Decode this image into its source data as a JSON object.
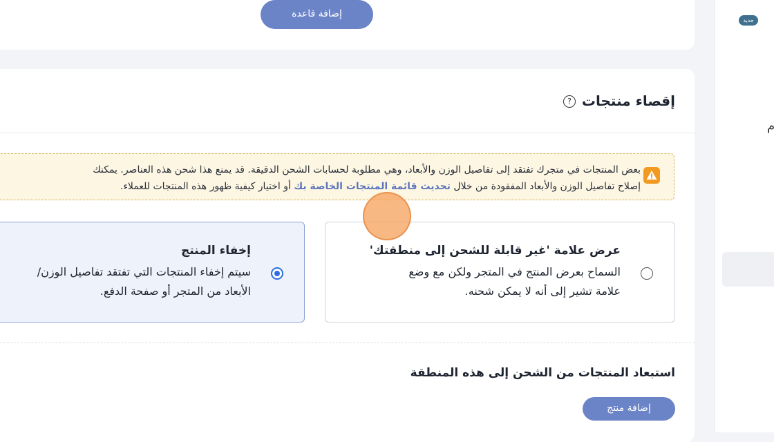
{
  "sidebar": {
    "new_badge": "جديد",
    "partial_glyph": "م"
  },
  "rules": {
    "add_rule_button": "إضافة قاعدة"
  },
  "exclusion": {
    "title": "إقصاء منتجات",
    "help_icon_glyph": "?",
    "warning": {
      "icon": "warning-triangle-icon",
      "line1": "بعض المنتجات في متجرك تفتقد إلى تفاصيل الوزن والأبعاد، وهي مطلوبة لحسابات الشحن الدقيقة. قد يمنع هذا شحن هذه العناصر. يمكنك",
      "line2_before": "إصلاح تفاصيل الوزن والأبعاد المفقودة من خلال",
      "line2_link": "تحديث قائمة المنتجات الخاصة بك",
      "line2_after": "أو اختيار كيفية ظهور هذه المنتجات للعملاء."
    },
    "options": [
      {
        "title": "عرض علامة 'غير قابلة للشحن إلى منطقتك'",
        "desc_line1": "السماح بعرض المنتج في المتجر ولكن مع وضع",
        "desc_line2": "علامة تشير إلى أنه لا يمكن شحنه.",
        "selected": false
      },
      {
        "title": "إخفاء المنتج",
        "desc_line1": "سيتم إخفاء المنتجات التي تفتقد تفاصيل الوزن/",
        "desc_line2": "الأبعاد من المتجر أو صفحة الدفع.",
        "selected": true
      }
    ]
  },
  "exclude_products": {
    "title": "استبعاد المنتجات من الشحن إلى هذه المنطقة",
    "add_button": "إضافة منتج"
  },
  "colors": {
    "accent": "#6b84c8",
    "link": "#5c76bd",
    "warning": "#f29a1f",
    "radio_selected": "#2c6fe0"
  }
}
